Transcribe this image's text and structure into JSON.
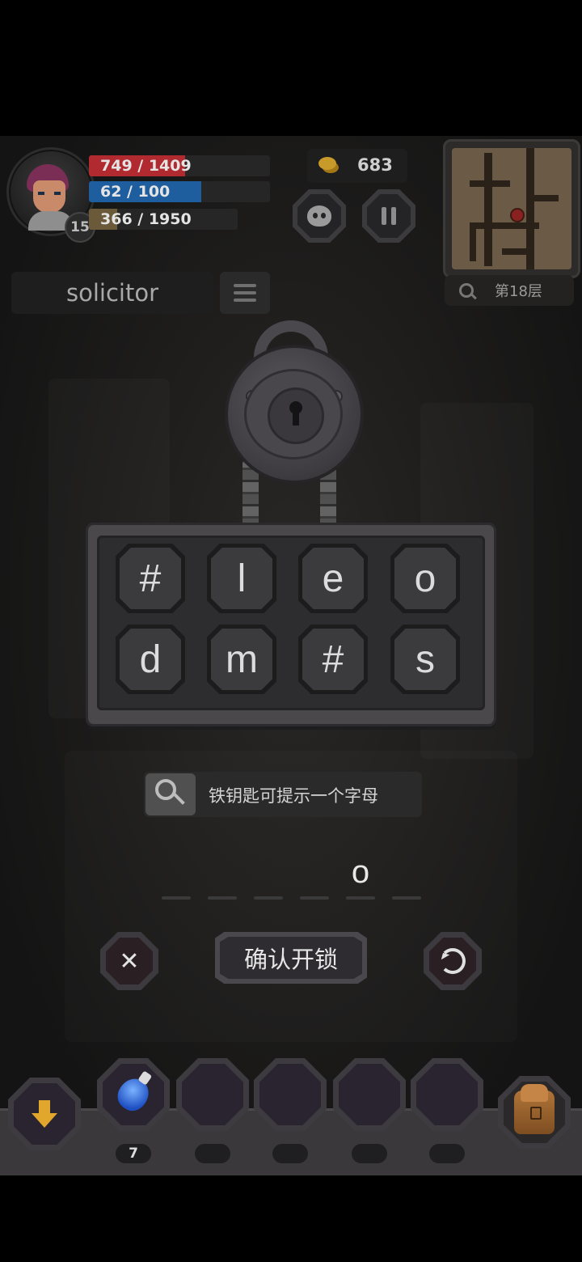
{
  "hud": {
    "level": "15",
    "hp": {
      "text": "749 / 1409",
      "fraction": 0.53,
      "color": "#b02a2f"
    },
    "mp": {
      "text": "62 / 100",
      "fraction": 0.62,
      "color": "#1e5d9e"
    },
    "exp": {
      "text": "366 / 1950",
      "fraction": 0.19,
      "color": "#6a5a3a"
    },
    "coins": "683",
    "floor": "第18层"
  },
  "word": "solicitor",
  "letters": [
    "#",
    "l",
    "e",
    "o",
    "d",
    "m",
    "#",
    "s"
  ],
  "hint_text": "铁钥匙可提示一个字母",
  "answer_slots": [
    "",
    "",
    "",
    "",
    "o",
    ""
  ],
  "buttons": {
    "confirm": "确认开锁",
    "cancel_symbol": "✕"
  },
  "toolbar": {
    "potion_count": "7",
    "empty_slots": 4
  },
  "icons": {
    "pet": "pet-face-icon",
    "pause": "pause-icon",
    "search": "search-icon",
    "list": "list-icon",
    "key": "key-icon",
    "refresh": "refresh-icon",
    "download": "arrow-down-icon",
    "backpack": "backpack-icon",
    "potion": "potion-icon"
  }
}
